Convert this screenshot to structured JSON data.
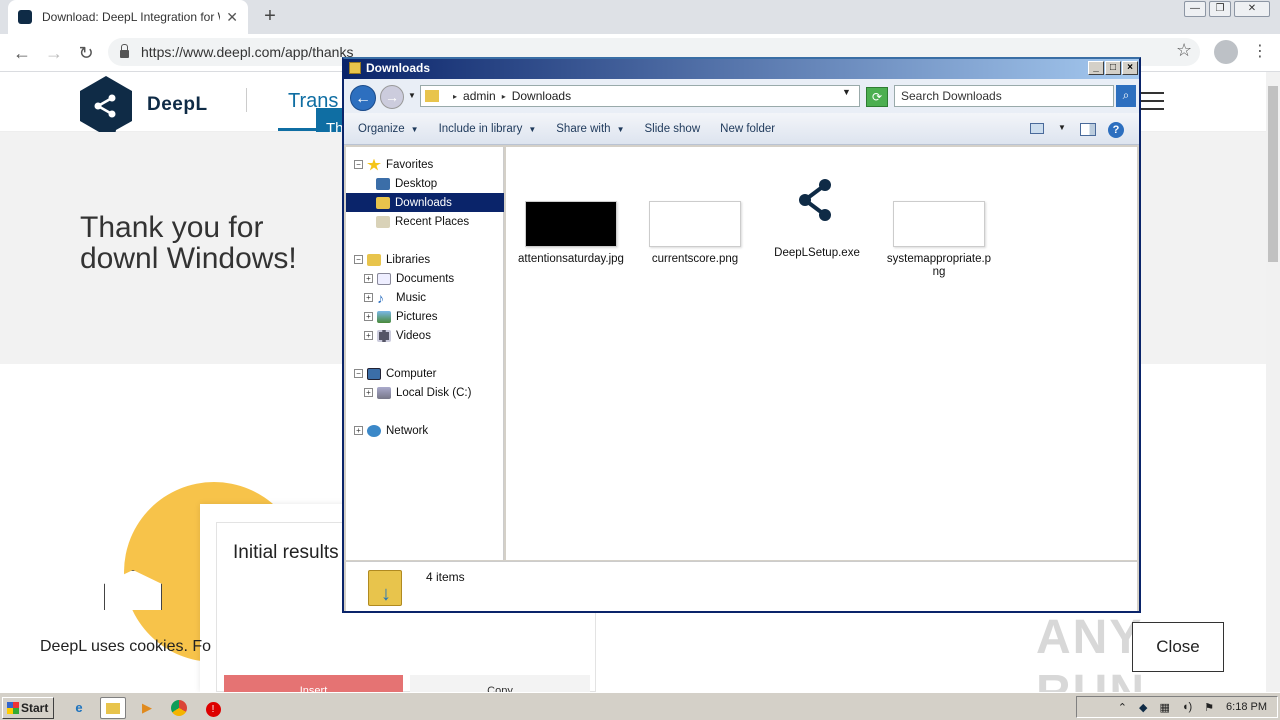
{
  "browser": {
    "tab_title": "Download: DeepL Integration for Wi",
    "tab_close": "✕",
    "new_tab": "+",
    "url": "https://www.deepl.com/app/thanks",
    "star": "☆",
    "menu": "⋮",
    "back": "←",
    "forward": "→",
    "reload": "↻",
    "win_min": "—",
    "win_max": "❐",
    "win_close": "✕"
  },
  "page": {
    "brand": "DeepL",
    "nav_translate": "Trans",
    "tooltip": "Th",
    "hero_text": "Thank you for downl Windows!",
    "card_title": "Initial results",
    "cookie_text": "DeepL uses cookies. Fo",
    "insert_label": "Insert",
    "copy_label": "Copy",
    "close_label": "Close",
    "watermark": "ANY RUN"
  },
  "explorer": {
    "title": "Downloads",
    "path": [
      "admin",
      "Downloads"
    ],
    "search_placeholder": "Search Downloads",
    "commands": [
      {
        "label": "Organize",
        "dropdown": true
      },
      {
        "label": "Include in library",
        "dropdown": true
      },
      {
        "label": "Share with",
        "dropdown": true
      },
      {
        "label": "Slide show",
        "dropdown": false
      },
      {
        "label": "New folder",
        "dropdown": false
      }
    ],
    "tree": [
      {
        "label": "Favorites",
        "icon": "star-icon",
        "toggle": "−"
      },
      {
        "label": "Desktop",
        "icon": "desktop-icon"
      },
      {
        "label": "Downloads",
        "icon": "downloads-folder-icon",
        "selected": true
      },
      {
        "label": "Recent Places",
        "icon": "recent-places-icon"
      },
      {
        "label": "Libraries",
        "icon": "libraries-icon",
        "toggle": "−"
      },
      {
        "label": "Documents",
        "icon": "documents-icon",
        "toggle": "+"
      },
      {
        "label": "Music",
        "icon": "music-icon",
        "toggle": "+"
      },
      {
        "label": "Pictures",
        "icon": "pictures-icon",
        "toggle": "+"
      },
      {
        "label": "Videos",
        "icon": "videos-icon",
        "toggle": "+"
      },
      {
        "label": "Computer",
        "icon": "computer-icon",
        "toggle": "−"
      },
      {
        "label": "Local Disk (C:)",
        "icon": "disk-icon",
        "toggle": "+"
      },
      {
        "label": "Network",
        "icon": "network-icon",
        "toggle": "+"
      }
    ],
    "files": [
      {
        "name": "attentionsaturday.jpg",
        "kind": "image-dark"
      },
      {
        "name": "currentscore.png",
        "kind": "image-light"
      },
      {
        "name": "DeepLSetup.exe",
        "kind": "exe"
      },
      {
        "name": "systemappropriate.png",
        "kind": "image-light"
      }
    ],
    "status": "4 items"
  },
  "taskbar": {
    "start": "Start",
    "clock": "6:18 PM"
  },
  "colors": {
    "deepl_navy": "#0f2b46",
    "deepl_blue": "#0f6ea3",
    "selection": "#0a246a"
  }
}
